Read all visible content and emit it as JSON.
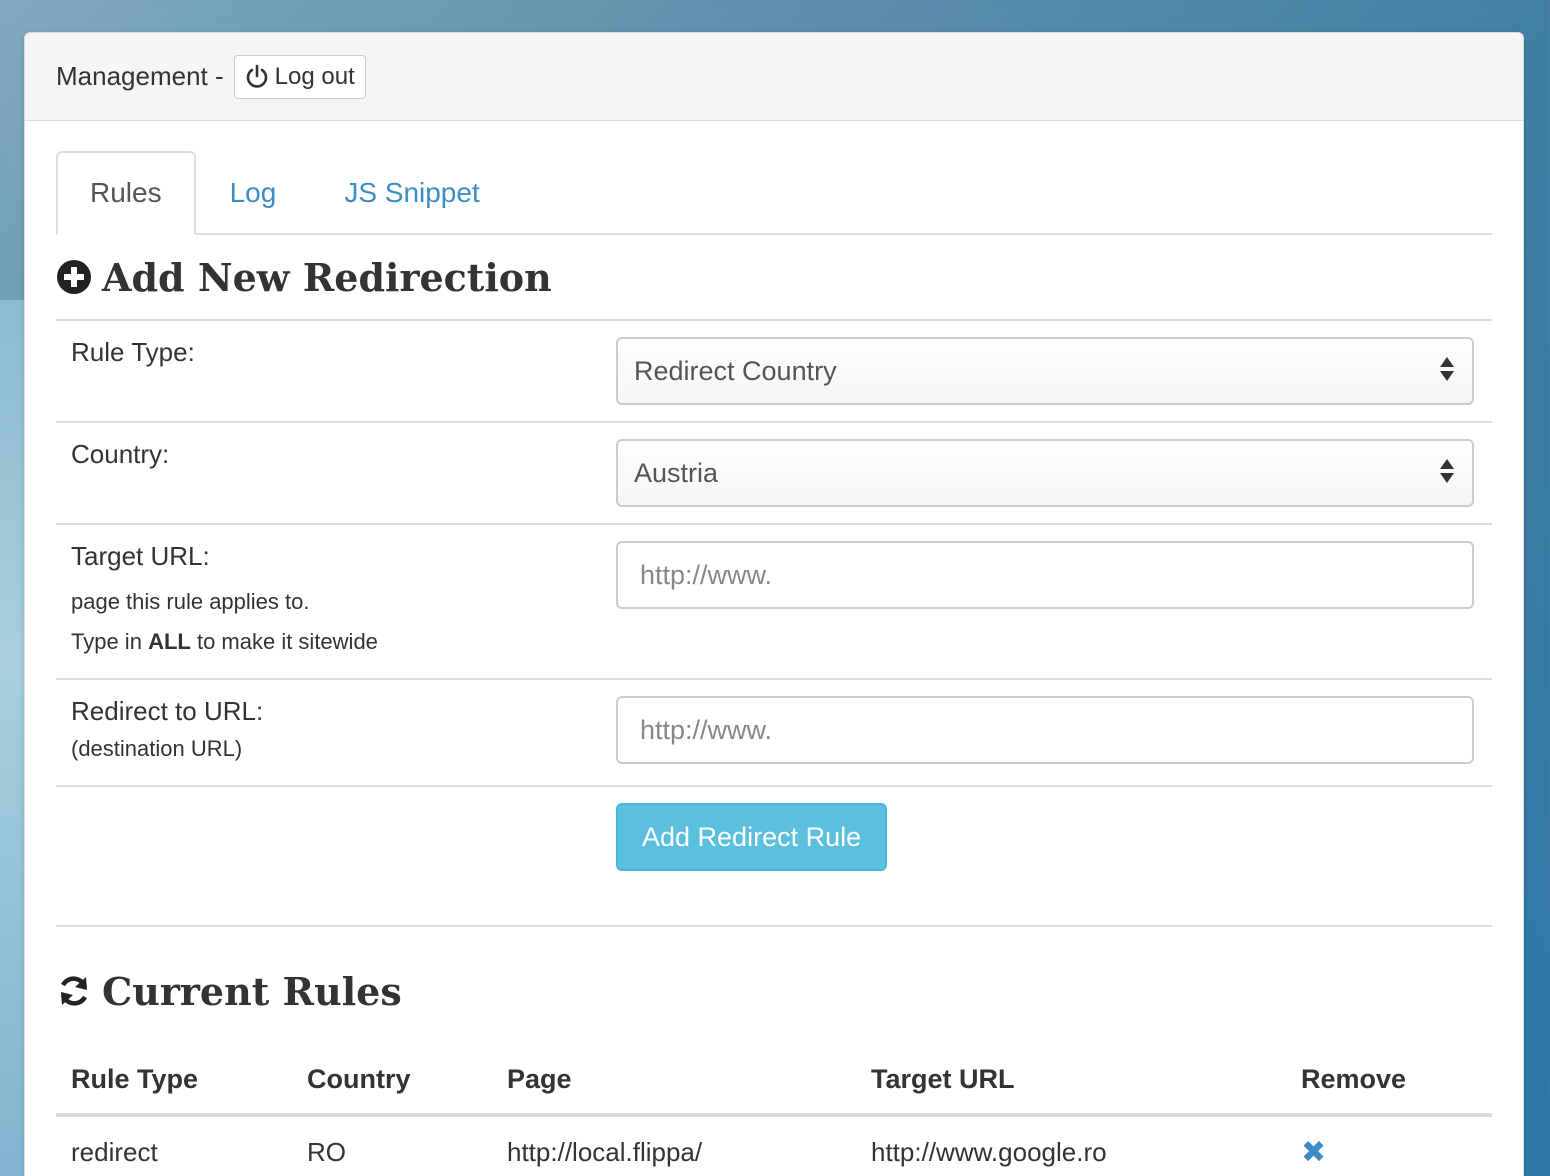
{
  "header": {
    "title": "Management -",
    "logout_label": "Log out"
  },
  "tabs": [
    {
      "label": "Rules",
      "active": true
    },
    {
      "label": "Log",
      "active": false
    },
    {
      "label": "JS Snippet",
      "active": false
    }
  ],
  "add_section": {
    "title": "Add New Redirection",
    "icon": "plus-circle-icon",
    "rule_type": {
      "label": "Rule Type:",
      "value": "Redirect Country"
    },
    "country": {
      "label": "Country:",
      "value": "Austria"
    },
    "target_url": {
      "label": "Target URL:",
      "sub1": "page this rule applies to.",
      "sub2_pre": "Type in",
      "sub2_bold": "ALL",
      "sub2_post": "to make it sitewide",
      "placeholder": "http://www."
    },
    "redirect_url": {
      "label": "Redirect to URL:",
      "sub": "(destination URL)",
      "placeholder": "http://www."
    },
    "submit_label": "Add Redirect Rule"
  },
  "rules_section": {
    "title": "Current Rules",
    "icon": "refresh-icon",
    "columns": [
      "Rule Type",
      "Country",
      "Page",
      "Target URL",
      "Remove"
    ],
    "rows": [
      {
        "rule_type": "redirect",
        "country": "RO",
        "page": "http://local.flippa/",
        "target_url": "http://www.google.ro",
        "remove_icon": "close-icon"
      }
    ]
  },
  "colors": {
    "link": "#3c8dc5",
    "info_button": "#5bc0de"
  }
}
